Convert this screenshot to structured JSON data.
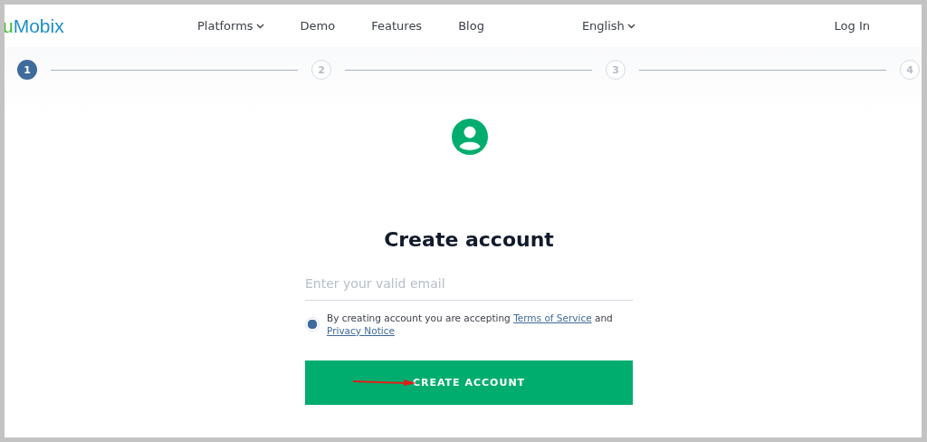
{
  "header": {
    "logo": {
      "accent": "u",
      "rest": "Mobix"
    },
    "nav": [
      {
        "label": "Platforms",
        "dropdown": true
      },
      {
        "label": "Demo",
        "dropdown": false
      },
      {
        "label": "Features",
        "dropdown": false
      },
      {
        "label": "Blog",
        "dropdown": false
      }
    ],
    "language": {
      "label": "English",
      "dropdown": true
    },
    "login": "Log In"
  },
  "stepper": [
    {
      "label": "1",
      "selected": true
    },
    {
      "label": "2",
      "selected": false
    },
    {
      "label": "3",
      "selected": false
    },
    {
      "label": "4",
      "selected": false
    }
  ],
  "form": {
    "title": "Create account",
    "email": {
      "placeholder": "Enter your valid email"
    },
    "consent": {
      "checked": true,
      "text": "By creating account you are accepting",
      "terms_link": "Terms of Service",
      "joiner": "and",
      "privacy_link": "Privacy Notice"
    },
    "submit": "CREATE ACCOUNT"
  }
}
